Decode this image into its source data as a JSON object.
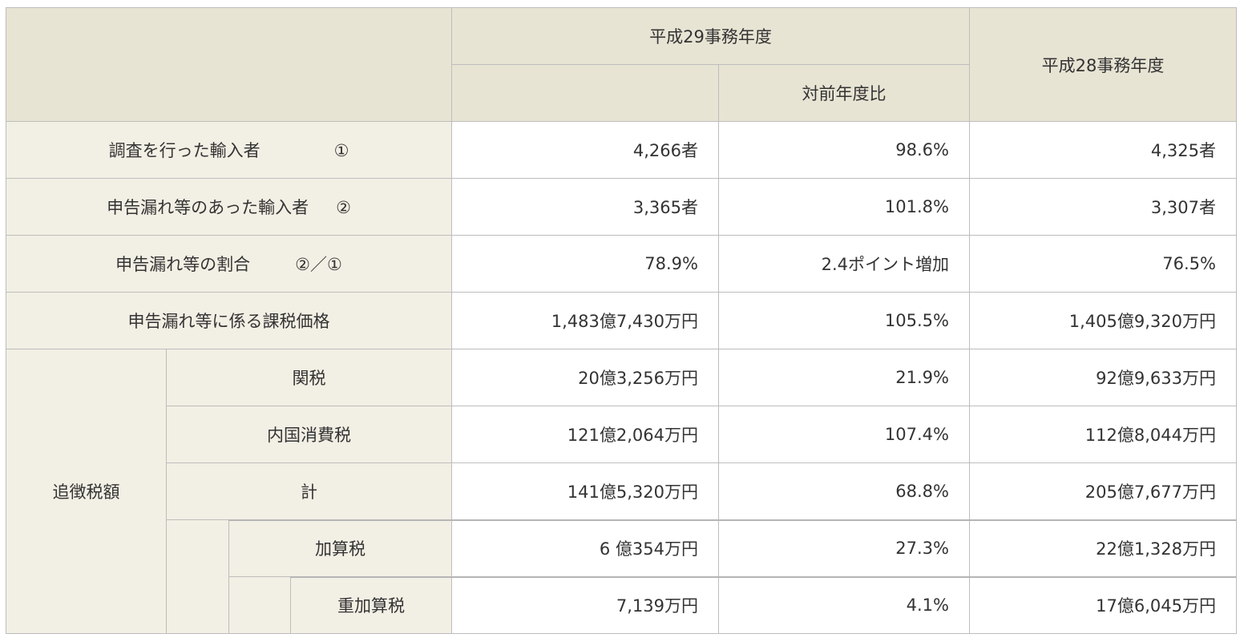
{
  "header": {
    "fy29": "平成29事務年度",
    "yoy": "対前年度比",
    "fy28": "平成28事務年度"
  },
  "rows": [
    {
      "label": "調査を行った輸入者",
      "mark": "①",
      "fy29": "4,266者",
      "yoy": "98.6%",
      "fy28": "4,325者"
    },
    {
      "label": "申告漏れ等のあった輸入者",
      "mark": "②",
      "fy29": "3,365者",
      "yoy": "101.8%",
      "fy28": "3,307者"
    },
    {
      "label": "申告漏れ等の割合",
      "mark": "②／①",
      "fy29": "78.9%",
      "yoy": "2.4ポイント増加",
      "fy28": "76.5%"
    },
    {
      "label": "申告漏れ等に係る課税価格",
      "mark": "",
      "fy29": "1,483億7,430万円",
      "yoy": "105.5%",
      "fy28": "1,405億9,320万円"
    }
  ],
  "additional_tax": {
    "group_label": "追徴税額",
    "rows": [
      {
        "label": "関税",
        "fy29": "20億3,256万円",
        "yoy": "21.9%",
        "fy28": "92億9,633万円"
      },
      {
        "label": "内国消費税",
        "fy29": "121億2,064万円",
        "yoy": "107.4%",
        "fy28": "112億8,044万円"
      },
      {
        "label": "計",
        "fy29": "141億5,320万円",
        "yoy": "68.8%",
        "fy28": "205億7,677万円"
      },
      {
        "label": "加算税",
        "fy29": "6 億354万円",
        "yoy": "27.3%",
        "fy28": "22億1,328万円"
      },
      {
        "label": "重加算税",
        "fy29": "7,139万円",
        "yoy": "4.1%",
        "fy28": "17億6,045万円"
      }
    ]
  }
}
